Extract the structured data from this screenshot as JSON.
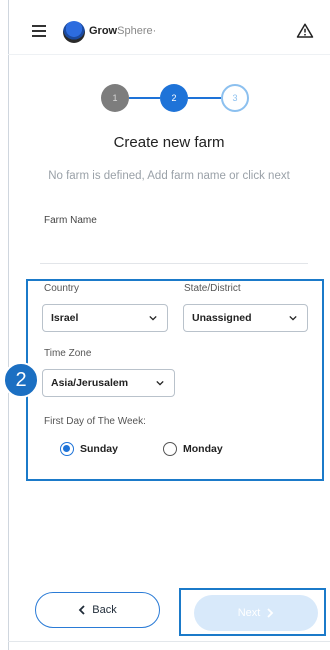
{
  "header": {
    "logo_bold": "Grow",
    "logo_thin": "Sphere",
    "logo_tm": "·",
    "icons": [
      "hamburger-menu-icon",
      "growsphere-logo-icon",
      "warning-icon"
    ]
  },
  "stepper": {
    "steps": [
      "1",
      "2",
      "3"
    ],
    "current_step": 2,
    "colors": {
      "done": "#7d7d7d",
      "active": "#1e73d8",
      "pending": "#8cc0ef"
    }
  },
  "page": {
    "title": "Create new farm",
    "subtitle": "No farm is defined, Add farm name or click next"
  },
  "form": {
    "farm_name_label": "Farm Name",
    "farm_name_value": "",
    "country_label": "Country",
    "country_value": "Israel",
    "state_label": "State/District",
    "state_value": "Unassigned",
    "timezone_label": "Time Zone",
    "timezone_value": "Asia/Jerusalem",
    "first_day_label": "First Day of The Week:",
    "first_day_options": [
      "Sunday",
      "Monday"
    ],
    "first_day_selected": "Sunday"
  },
  "annotation": {
    "badge": "2",
    "highlight_color": "#1b7ac9"
  },
  "footer": {
    "back_label": "Back",
    "next_label": "Next",
    "accent": "#1e73d8"
  }
}
